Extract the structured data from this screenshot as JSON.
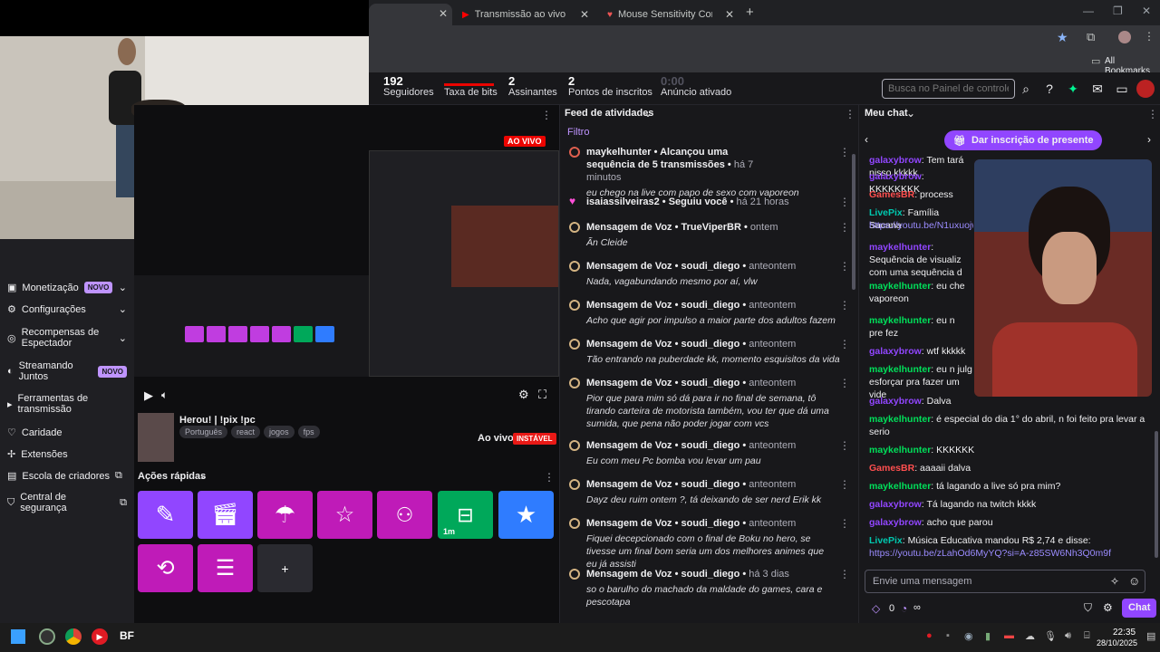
{
  "browser": {
    "tabs": [
      {
        "label": "Transmissão ao vivo - YouTube"
      },
      {
        "label": "Mouse Sensitivity Converter and"
      }
    ],
    "bookmarks_label": "All Bookmarks"
  },
  "stats": [
    {
      "value": "192",
      "label": "Seguidores"
    },
    {
      "value": "",
      "label": "Taxa de bits"
    },
    {
      "value": "2",
      "label": "Assinantes"
    },
    {
      "value": "2",
      "label": "Pontos de inscritos"
    },
    {
      "value": "0:00",
      "label": "Anúncio ativado"
    }
  ],
  "search": {
    "placeholder": "Busca no Painel de controle (C"
  },
  "nav": [
    {
      "label": "Monetização",
      "badge": "NOVO"
    },
    {
      "label": "Configurações"
    },
    {
      "label": "Recompensas de Espectador"
    },
    {
      "label": "Streamando Juntos",
      "badge": "NOVO"
    },
    {
      "label": "Ferramentas de transmissão"
    },
    {
      "label": "Caridade"
    },
    {
      "label": "Extensões"
    },
    {
      "label": "Escola de criadores"
    },
    {
      "label": "Central de segurança"
    }
  ],
  "preview": {
    "live_badge": "AO VIVO"
  },
  "stream": {
    "title": "Herou! | !pix !pc",
    "tags": [
      "Português",
      "react",
      "jogos",
      "fps"
    ],
    "status": "Ao vivo",
    "status_badge": "INSTÁVEL"
  },
  "quick_actions": {
    "title": "Ações rápidas",
    "timer": "1m",
    "add": "+"
  },
  "feed": {
    "title": "Feed de atividades",
    "filter": "Filtro",
    "items": [
      {
        "who": "maykelhunter",
        "action": "Alcançou uma sequência de 5 transmissões",
        "time": "há 7 minutos",
        "msg": "eu chego na live com papo de sexo com vaporeon"
      },
      {
        "who": "isaiassilveiras2",
        "action": "Seguiu você",
        "time": "há 21 horas",
        "msg": ""
      },
      {
        "who": "Mensagem de Voz",
        "action": "TrueViperBR",
        "time": "ontem",
        "msg": "Ãn Cleide"
      },
      {
        "who": "Mensagem de Voz",
        "action": "soudi_diego",
        "time": "anteontem",
        "msg": "Nada, vagabundando mesmo por aí, vlw"
      },
      {
        "who": "Mensagem de Voz",
        "action": "soudi_diego",
        "time": "anteontem",
        "msg": "Acho que agir por impulso a maior parte dos adultos fazem"
      },
      {
        "who": "Mensagem de Voz",
        "action": "soudi_diego",
        "time": "anteontem",
        "msg": "Tão entrando na puberdade kk, momento esquisitos da vida"
      },
      {
        "who": "Mensagem de Voz",
        "action": "soudi_diego",
        "time": "anteontem",
        "msg": "Pior que para mim só dá para ir no final de semana, tô tirando carteira de motorista também, vou ter que dá uma sumida, que pena não poder jogar com vcs"
      },
      {
        "who": "Mensagem de Voz",
        "action": "soudi_diego",
        "time": "anteontem",
        "msg": "Eu com meu Pc bomba vou levar um pau"
      },
      {
        "who": "Mensagem de Voz",
        "action": "soudi_diego",
        "time": "anteontem",
        "msg": "Dayz deu ruim ontem ?, tá deixando de ser nerd Erik kk"
      },
      {
        "who": "Mensagem de Voz",
        "action": "soudi_diego",
        "time": "anteontem",
        "msg": "Fiquei decepcionado com o final de Boku no hero, se tivesse um final bom seria um dos melhores animes que eu já assisti"
      },
      {
        "who": "Mensagem de Voz",
        "action": "soudi_diego",
        "time": "há 3 dias",
        "msg": "so o barulho do machado da maldade do games, cara e pescotapa"
      }
    ]
  },
  "chat": {
    "title": "Meu chat",
    "gift_button": "Dar inscrição de presente",
    "lines": [
      {
        "user": "galaxybrow",
        "text": "Tem tará nisso kkkkk",
        "color": "#9146ff"
      },
      {
        "user": "galaxybrow",
        "text": "KKKKKKKK",
        "color": "#9146ff"
      },
      {
        "user": "GamesBR",
        "text": "process",
        "color": "#ff4f4f"
      },
      {
        "user": "LivePix",
        "text": "Família Sacana",
        "color": "#00c8af"
      },
      {
        "user": "",
        "text": "https://youtu.be/N1uxuojw",
        "color": "#9b8cff"
      },
      {
        "user": "maykelhunter",
        "text": "Sequência de visualiz com uma sequência d",
        "color": "#9146ff"
      },
      {
        "user": "maykelhunter",
        "text": "eu che vaporeon",
        "color": "#00e05a"
      },
      {
        "user": "maykelhunter",
        "text": "eu n pre fez",
        "color": "#00e05a"
      },
      {
        "user": "galaxybrow",
        "text": "wtf kkkkk",
        "color": "#9146ff"
      },
      {
        "user": "maykelhunter",
        "text": "eu n julg esforçar pra fazer um vide",
        "color": "#00e05a"
      },
      {
        "user": "galaxybrow",
        "text": "Dalva",
        "color": "#9146ff"
      },
      {
        "user": "maykelhunter",
        "text": "é especial do dia 1° do abril, n foi feito pra levar a serio",
        "color": "#00e05a"
      },
      {
        "user": "maykelhunter",
        "text": "KKKKKK",
        "color": "#00e05a"
      },
      {
        "user": "GamesBR",
        "text": "aaaaii dalva",
        "color": "#ff4f4f"
      },
      {
        "user": "maykelhunter",
        "text": "tá lagando a live só pra mim?",
        "color": "#00e05a"
      },
      {
        "user": "galaxybrow",
        "text": "Tá lagando na twitch kkkk",
        "color": "#9146ff"
      },
      {
        "user": "galaxybrow",
        "text": "acho que parou",
        "color": "#9146ff"
      },
      {
        "user": "LivePix",
        "text": "Música Educativa mandou R$ 2,74 e disse:",
        "color": "#00c8af"
      },
      {
        "user": "",
        "text": "https://youtu.be/zLahOd6MyYQ?si=A-z85SW6Nh3Q0m9f",
        "color": "#9b8cff"
      }
    ],
    "input_placeholder": "Envie uma mensagem",
    "points": "0",
    "chat_button": "Chat",
    "infinity": "∞"
  },
  "taskbar": {
    "time": "22:35",
    "date": "28/10/2025"
  }
}
